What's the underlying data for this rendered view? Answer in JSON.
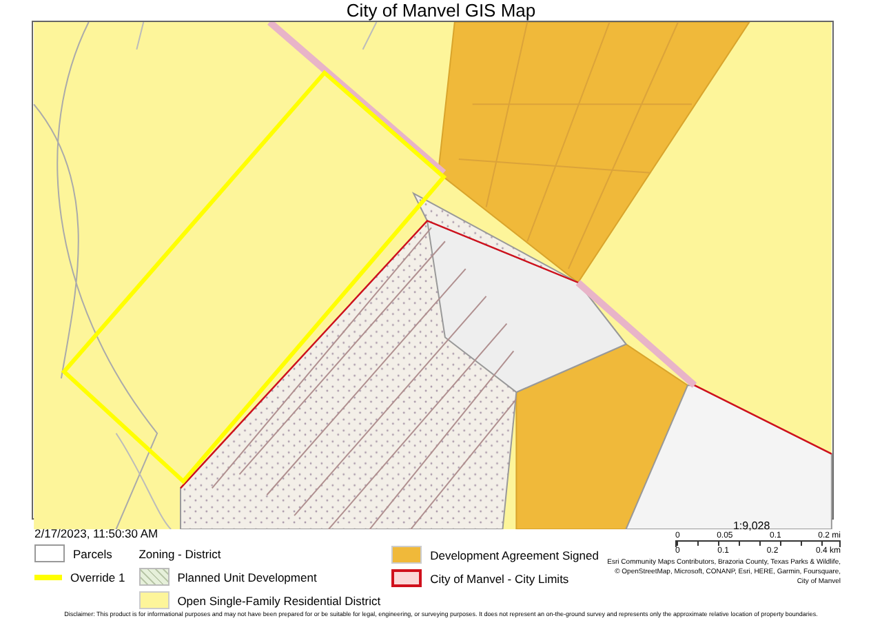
{
  "title": "City of Manvel GIS Map",
  "timestamp": "2/17/2023, 11:50:30 AM",
  "legend": {
    "group_title": "Zoning - District",
    "items": [
      {
        "label": "Parcels",
        "kind": "outline",
        "color": "#ffffff"
      },
      {
        "label": "Override 1",
        "kind": "line",
        "color": "#ffff00"
      },
      {
        "label": "Planned Unit Development",
        "kind": "hatch",
        "color": "#e6f0da"
      },
      {
        "label": "Open Single-Family Residential District",
        "kind": "fill",
        "color": "#fdf59a"
      },
      {
        "label": "Development Agreement Signed",
        "kind": "fill",
        "color": "#f0b93a"
      },
      {
        "label": "City of Manvel - City Limits",
        "kind": "border",
        "color": "#d0101c"
      }
    ]
  },
  "scale": {
    "ratio": "1:9,028",
    "top_labels": [
      "0",
      "0.05",
      "0.1",
      "0.2 mi"
    ],
    "bottom_labels": [
      "0",
      "0.1",
      "0.2",
      "0.4 km"
    ]
  },
  "attribution": [
    "Esri Community Maps Contributors, Brazoria County, Texas Parks & Wildlife,",
    "© OpenStreetMap, Microsoft, CONANP, Esri, HERE, Garmin, Foursquare,",
    "City of Manvel"
  ],
  "disclaimer": "Disclaimer: This product is for informational purposes and may not have been prepared for or be suitable for legal, engineering, or surveying purposes. It does not represent an on-the-ground survey and represents only the approximate relative location of property boundaries."
}
